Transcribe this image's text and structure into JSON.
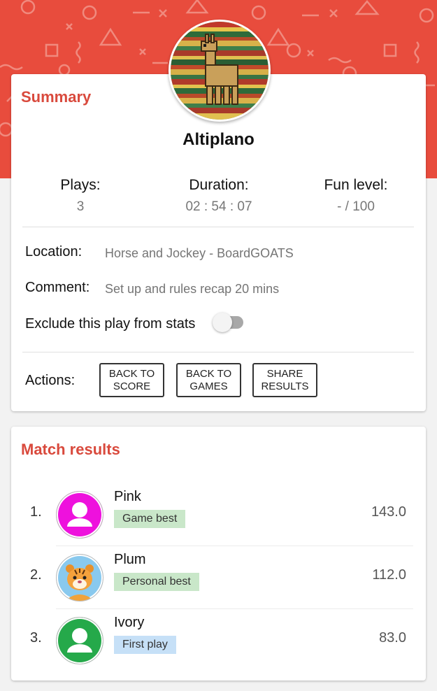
{
  "summary": {
    "title": "Summary",
    "game_name": "Altiplano",
    "stats": {
      "plays_label": "Plays:",
      "plays_value": "3",
      "duration_label": "Duration:",
      "duration_value": "02 : 54 : 07",
      "fun_label": "Fun level:",
      "fun_value": "- / 100"
    },
    "location_label": "Location:",
    "location_value": "Horse and Jockey  - BoardGOATS",
    "comment_label": "Comment:",
    "comment_value": "Set up and rules recap 20 mins",
    "exclude_label": "Exclude this play from stats",
    "exclude_checked": false,
    "actions_label": "Actions:",
    "actions": [
      "BACK TO SCORE",
      "BACK TO GAMES",
      "SHARE RESULTS"
    ]
  },
  "results": {
    "title": "Match results",
    "players": [
      {
        "rank": "1.",
        "name": "Pink",
        "badge": "Game best",
        "score": "143.0",
        "avatar_color": "#ee11dd",
        "avatar_icon": "person-icon"
      },
      {
        "rank": "2.",
        "name": "Plum",
        "badge": "Personal best",
        "score": "112.0",
        "avatar_color": "#89c9ee",
        "avatar_icon": "tiger-icon"
      },
      {
        "rank": "3.",
        "name": "Ivory",
        "badge": "First play",
        "score": "83.0",
        "avatar_color": "#25a94a",
        "avatar_icon": "person-icon"
      }
    ]
  },
  "colors": {
    "header": "#e84c3d",
    "accent": "#d94a3d",
    "badge_green": "#c9e7c9",
    "badge_blue": "#c6e0f7"
  }
}
